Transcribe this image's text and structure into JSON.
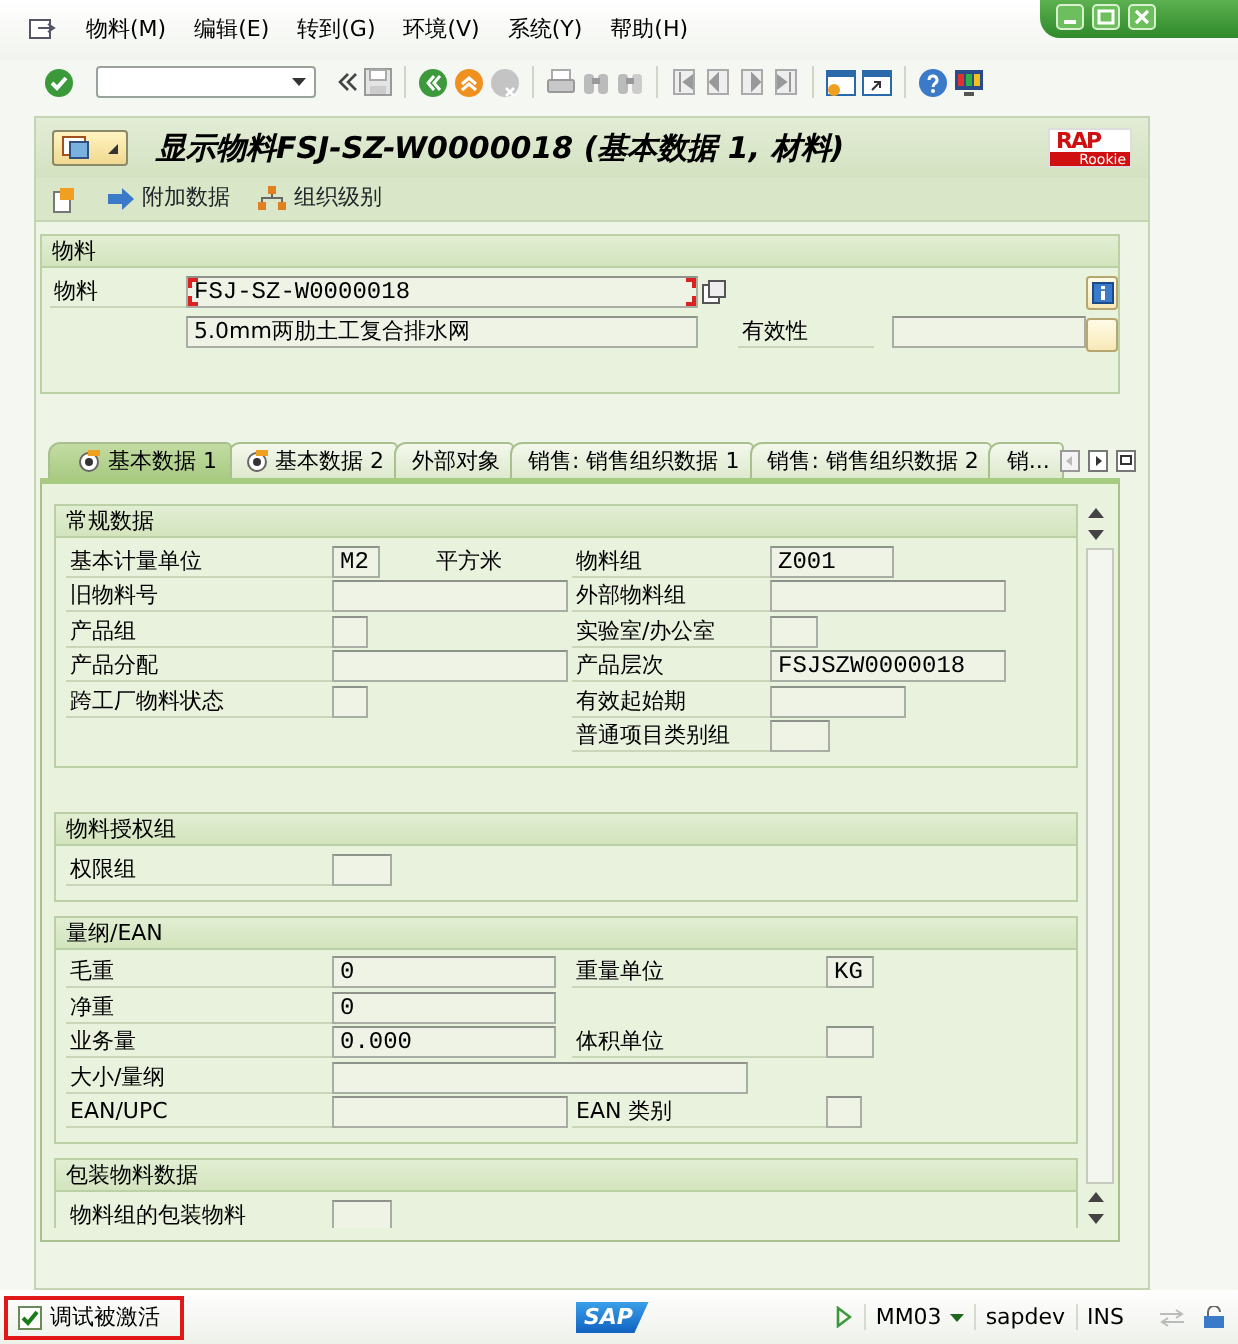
{
  "menu": [
    "物料(M)",
    "编辑(E)",
    "转到(G)",
    "环境(V)",
    "系统(Y)",
    "帮助(H)"
  ],
  "title": "显示物料FSJ-SZ-W0000018 (基本数据 1, 材料)",
  "logo": {
    "main": "RAP",
    "sub": "Rookie"
  },
  "app_toolbar": [
    "附加数据",
    "组织级别"
  ],
  "header": {
    "title": "物料",
    "material_label": "物料",
    "material_value": "FSJ-SZ-W0000018",
    "focused": true,
    "description": "5.0mm两肋土工复合排水网",
    "validity_label": "有效性"
  },
  "tabs": [
    {
      "label": "基本数据 1",
      "selected": true,
      "kind": "icon"
    },
    {
      "label": "基本数据 2",
      "selected": false,
      "kind": "icon"
    },
    {
      "label": "外部对象",
      "selected": false,
      "kind": "plain"
    },
    {
      "label": "销售: 销售组织数据 1",
      "selected": false,
      "kind": "plain"
    },
    {
      "label": "销售: 销售组织数据 2",
      "selected": false,
      "kind": "plain"
    },
    {
      "label": "销...",
      "selected": false,
      "kind": "plain"
    }
  ],
  "sections": [
    {
      "title": "常规数据",
      "rows": [
        {
          "left": {
            "label": "基本计量单位",
            "value": "M2",
            "unit": "平方米"
          },
          "right": {
            "label": "物料组",
            "value": "Z001"
          }
        },
        {
          "left": {
            "label": "旧物料号"
          },
          "right": {
            "label": "外部物料组"
          }
        },
        {
          "left": {
            "label": "产品组"
          },
          "right": {
            "label": "实验室/办公室"
          }
        },
        {
          "left": {
            "label": "产品分配"
          },
          "right": {
            "label": "产品层次",
            "value": "FSJSZW0000018"
          }
        },
        {
          "left": {
            "label": "跨工厂物料状态"
          },
          "right": {
            "label": "有效起始期"
          }
        },
        {
          "right": {
            "label": "普通项目类别组"
          }
        }
      ]
    },
    {
      "title": "物料授权组",
      "rows": [
        {
          "left": {
            "label": "权限组"
          }
        }
      ]
    },
    {
      "title": "量纲/EAN",
      "rows": [
        {
          "left": {
            "label": "毛重",
            "value": "0"
          },
          "right": {
            "label": "重量单位",
            "value": "KG"
          }
        },
        {
          "left": {
            "label": "净重",
            "value": "0"
          }
        },
        {
          "left": {
            "label": "业务量",
            "value": "0.000"
          },
          "right": {
            "label": "体积单位"
          }
        },
        {
          "left": {
            "label": "大小/量纲"
          }
        },
        {
          "left": {
            "label": "EAN/UPC"
          },
          "right": {
            "label": "EAN 类别"
          }
        }
      ]
    },
    {
      "title": "包装物料数据",
      "rows": [
        {
          "left": {
            "label": "物料组的包装物料"
          }
        }
      ]
    }
  ],
  "status_bar": {
    "debug_label": "调试被激活",
    "debug_checked": true,
    "highlighted": true,
    "sap_logo": "SAP",
    "transaction": "MM03",
    "system": "sapdev",
    "mode": "INS"
  }
}
